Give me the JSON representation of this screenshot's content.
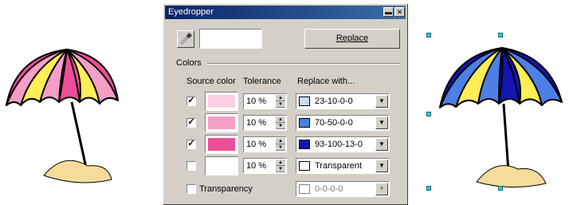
{
  "dialog": {
    "title": "Eyedropper",
    "minimize_glyph": "▬",
    "close_glyph": "✕",
    "pipette_icon": "pipette-icon",
    "replace_label": "Replace",
    "colors_section_label": "Colors",
    "headers": {
      "source_color": "Source color",
      "tolerance": "Tolerance",
      "replace_with": "Replace with..."
    },
    "rows": [
      {
        "checked": true,
        "check_glyph": "✓",
        "source_color": "#fbcfe2",
        "tolerance": "10 %",
        "replace_label": "23-10-0-0",
        "replace_color": "#c6dcf0"
      },
      {
        "checked": true,
        "check_glyph": "✓",
        "source_color": "#f59ec6",
        "tolerance": "10 %",
        "replace_label": "70-50-0-0",
        "replace_color": "#4d80e6"
      },
      {
        "checked": true,
        "check_glyph": "✓",
        "source_color": "#ee4e97",
        "tolerance": "10 %",
        "replace_label": "93-100-13-0",
        "replace_color": "#1414b0"
      },
      {
        "checked": false,
        "check_glyph": "",
        "source_color": "#ffffff",
        "tolerance": "10 %",
        "replace_label": "Transparent",
        "replace_color": "#ffffff"
      }
    ],
    "transparency": {
      "checked": false,
      "label": "Transparency",
      "replace_label": "0-0-0-0",
      "disabled": true
    },
    "dropdown_glyph": "▼",
    "spin_up_glyph": "▲",
    "spin_down_glyph": "▼"
  },
  "artwork": {
    "left": "pink-yellow-beach-umbrella",
    "right": "blue-yellow-beach-umbrella",
    "colors": {
      "pink_light": "#f59ec6",
      "pink_dark": "#ee4e97",
      "yellow": "#ffee55",
      "blue_light": "#4d80e6",
      "blue_dark": "#1414b0",
      "sand": "#f5dc9a"
    }
  }
}
